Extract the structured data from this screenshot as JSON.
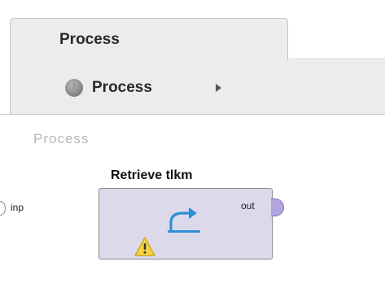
{
  "tab": {
    "label": "Process"
  },
  "breadcrumb": {
    "label": "Process",
    "icon": "process-circle-icon",
    "arrow_icon": "play-arrow-icon"
  },
  "canvas": {
    "title": "Process"
  },
  "operator": {
    "name": "Retrieve tlkm",
    "icon": "retrieve-arrow-icon",
    "warning_icon": "warning-triangle-icon",
    "fill_color": "#dcd9ea",
    "input_port": {
      "label": "inp"
    },
    "output_port": {
      "label": "out",
      "color": "#b3a6e0"
    }
  },
  "colors": {
    "panel_bg": "#ececec",
    "warning": "#f5d342",
    "icon_blue": "#2f8fd6"
  }
}
